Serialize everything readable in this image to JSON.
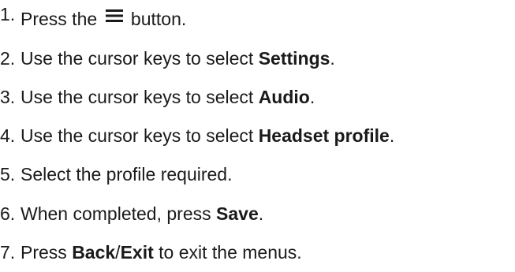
{
  "steps": [
    {
      "number": "1.",
      "before": "Press the ",
      "icon": "menu-icon",
      "after": " button."
    },
    {
      "number": "2.",
      "before": "Use the cursor keys to select ",
      "bold": "Settings",
      "after": "."
    },
    {
      "number": "3.",
      "before": "Use the cursor keys to select ",
      "bold": "Audio",
      "after": "."
    },
    {
      "number": "4.",
      "before": "Use the cursor keys to select ",
      "bold": "Headset profile",
      "after": "."
    },
    {
      "number": "5.",
      "text": "Select the profile required."
    },
    {
      "number": "6.",
      "before": "When completed, press ",
      "bold": "Save",
      "after": "."
    },
    {
      "number": "7.",
      "before": "Press ",
      "bold": "Back",
      "middle": "/",
      "bold2": "Exit",
      "after": " to exit the menus."
    }
  ]
}
